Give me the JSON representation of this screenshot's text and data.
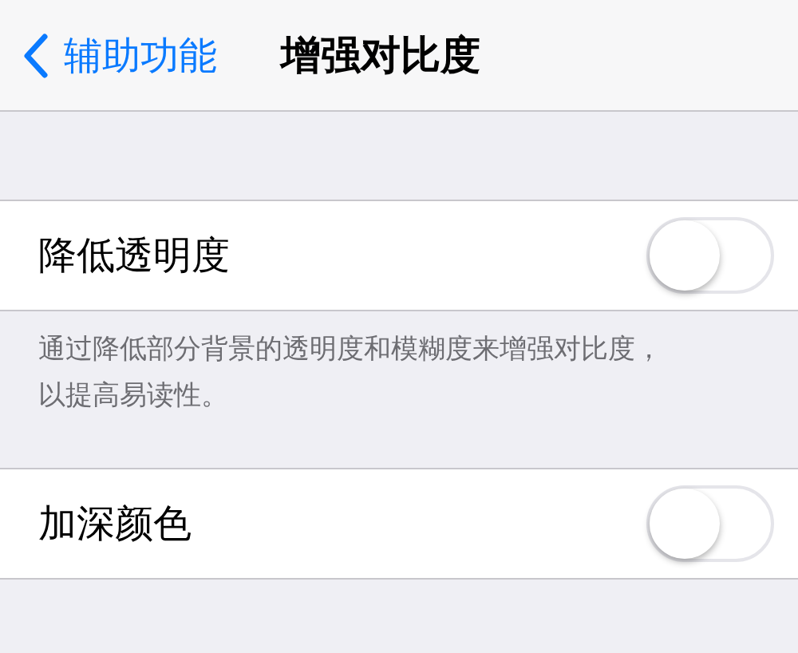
{
  "nav_bar": {
    "back_label": "辅助功能",
    "title": "增强对比度"
  },
  "groups": [
    {
      "rows": [
        {
          "label": "降低透明度",
          "on": false
        }
      ],
      "footer": "通过降低部分背景的透明度和模糊度来增强对比度，以提高易读性。"
    },
    {
      "rows": [
        {
          "label": "加深颜色",
          "on": false
        }
      ]
    }
  ]
}
